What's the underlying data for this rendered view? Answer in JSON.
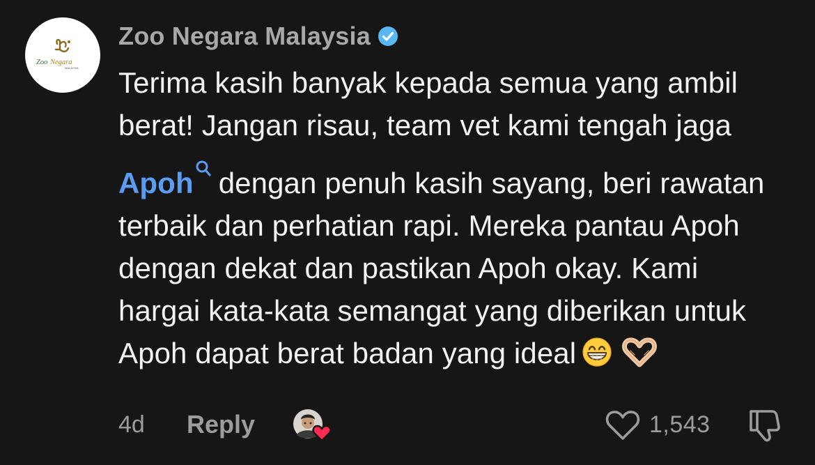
{
  "author": {
    "name": "Zoo Negara Malaysia",
    "verified": true,
    "avatar_logo_text": "ZooNegara",
    "avatar_logo_subtext": "MALAYSIA"
  },
  "comment": {
    "text_before_mention": "Terima kasih banyak kepada semua yang ambil berat! Jangan risau, team vet kami tengah jaga ",
    "mention": "Apoh",
    "text_after_mention": "dengan penuh kasih sayang, beri rawatan terbaik dan perhatian rapi. Mereka pantau Apoh dengan dekat dan pastikan Apoh okay. Kami hargai kata-kata semangat yang diberikan untuk Apoh dapat berat badan yang ideal",
    "emojis": [
      "grinning-face-with-smiling-eyes",
      "heart-hands"
    ]
  },
  "footer": {
    "timestamp": "4d",
    "reply_label": "Reply",
    "like_count": "1,543",
    "creator_liked": true
  },
  "colors": {
    "background": "#161616",
    "text": "#f2f2f2",
    "muted": "#9c9c9c",
    "link": "#5b9bf1",
    "verified": "#59b8f2",
    "creator_heart": "#fe2c55"
  }
}
